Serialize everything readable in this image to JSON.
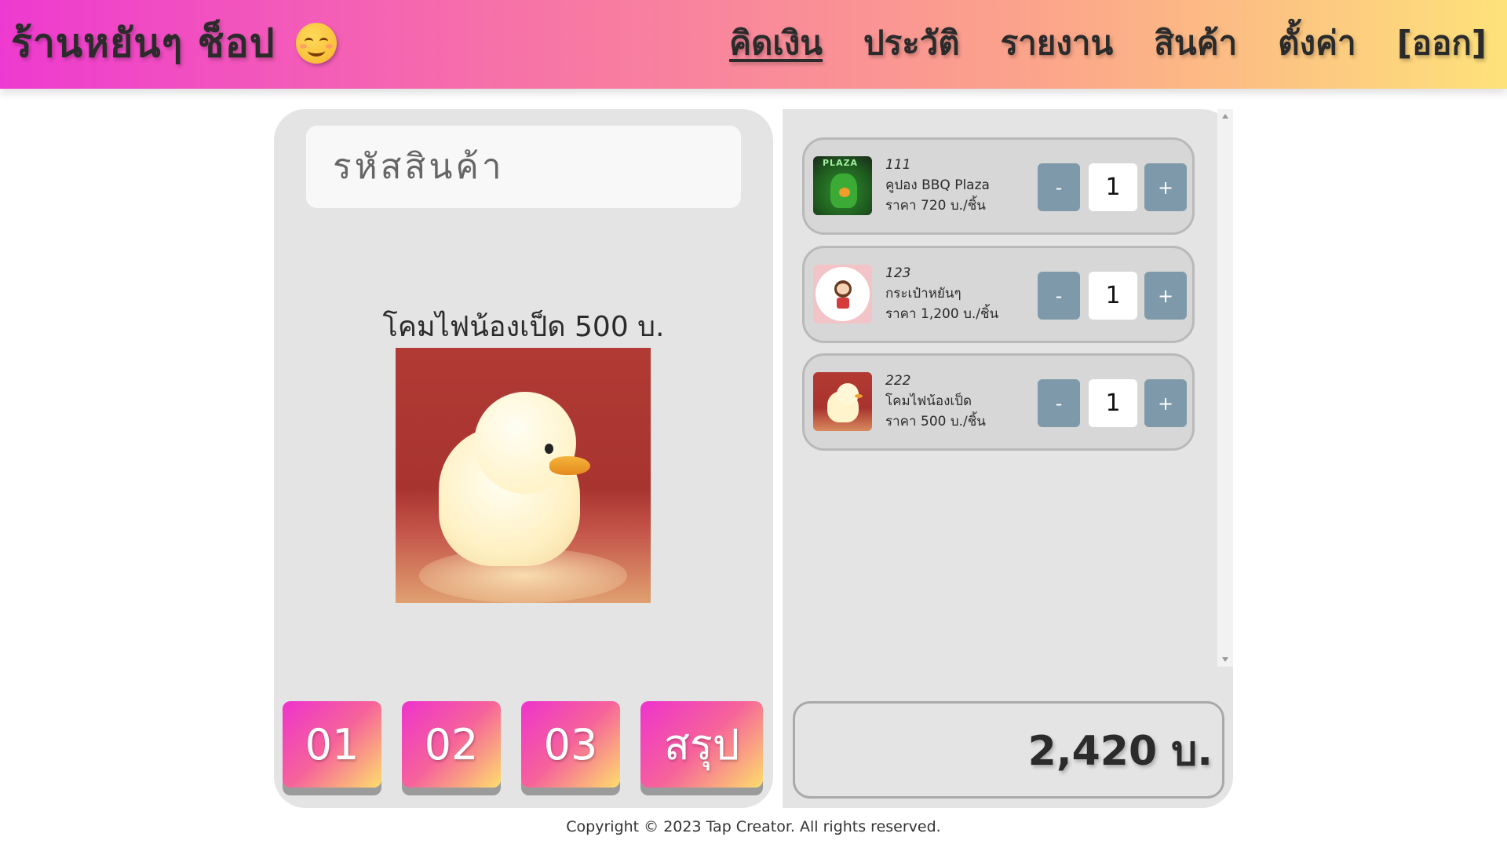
{
  "header": {
    "shop_name": "ร้านหยันๆ ช็อป",
    "emoji_icon": "smiling-face-icon",
    "nav": [
      {
        "label": "คิดเงิน",
        "active": true
      },
      {
        "label": "ประวัติ",
        "active": false
      },
      {
        "label": "รายงาน",
        "active": false
      },
      {
        "label": "สินค้า",
        "active": false
      },
      {
        "label": "ตั้งค่า",
        "active": false
      },
      {
        "label": "[ออก]",
        "active": false
      }
    ]
  },
  "scan": {
    "placeholder": "รหัสสินค้า",
    "value": ""
  },
  "current_product": {
    "name_price": "โคมไฟน้องเป็ด 500 บ.",
    "image": "duck-lamp-photo"
  },
  "quick_buttons": [
    {
      "label": "01"
    },
    {
      "label": "02"
    },
    {
      "label": "03"
    },
    {
      "label": "สรุป"
    }
  ],
  "cart": {
    "items": [
      {
        "code": "111",
        "name": "คูปอง BBQ Plaza",
        "price": "ราคา 720 บ./ชิ้น",
        "qty": "1",
        "image": "green-dino-photo"
      },
      {
        "code": "123",
        "name": "กระเป๋าหยันๆ",
        "price": "ราคา 1,200 บ./ชิ้น",
        "qty": "1",
        "image": "bag-logo-photo"
      },
      {
        "code": "222",
        "name": "โคมไฟน้องเป็ด",
        "price": "ราคา 500 บ./ชิ้น",
        "qty": "1",
        "image": "duck-lamp-photo"
      }
    ],
    "minus_label": "-",
    "plus_label": "+"
  },
  "total": "2,420 บ.",
  "footer": "Copyright © 2023 Tap Creator. All rights reserved.",
  "colors": {
    "gradient_start": "#ee3ad0",
    "gradient_end": "#fde27a",
    "qty_button": "#7e9aaa",
    "panel": "#e4e4e4"
  }
}
